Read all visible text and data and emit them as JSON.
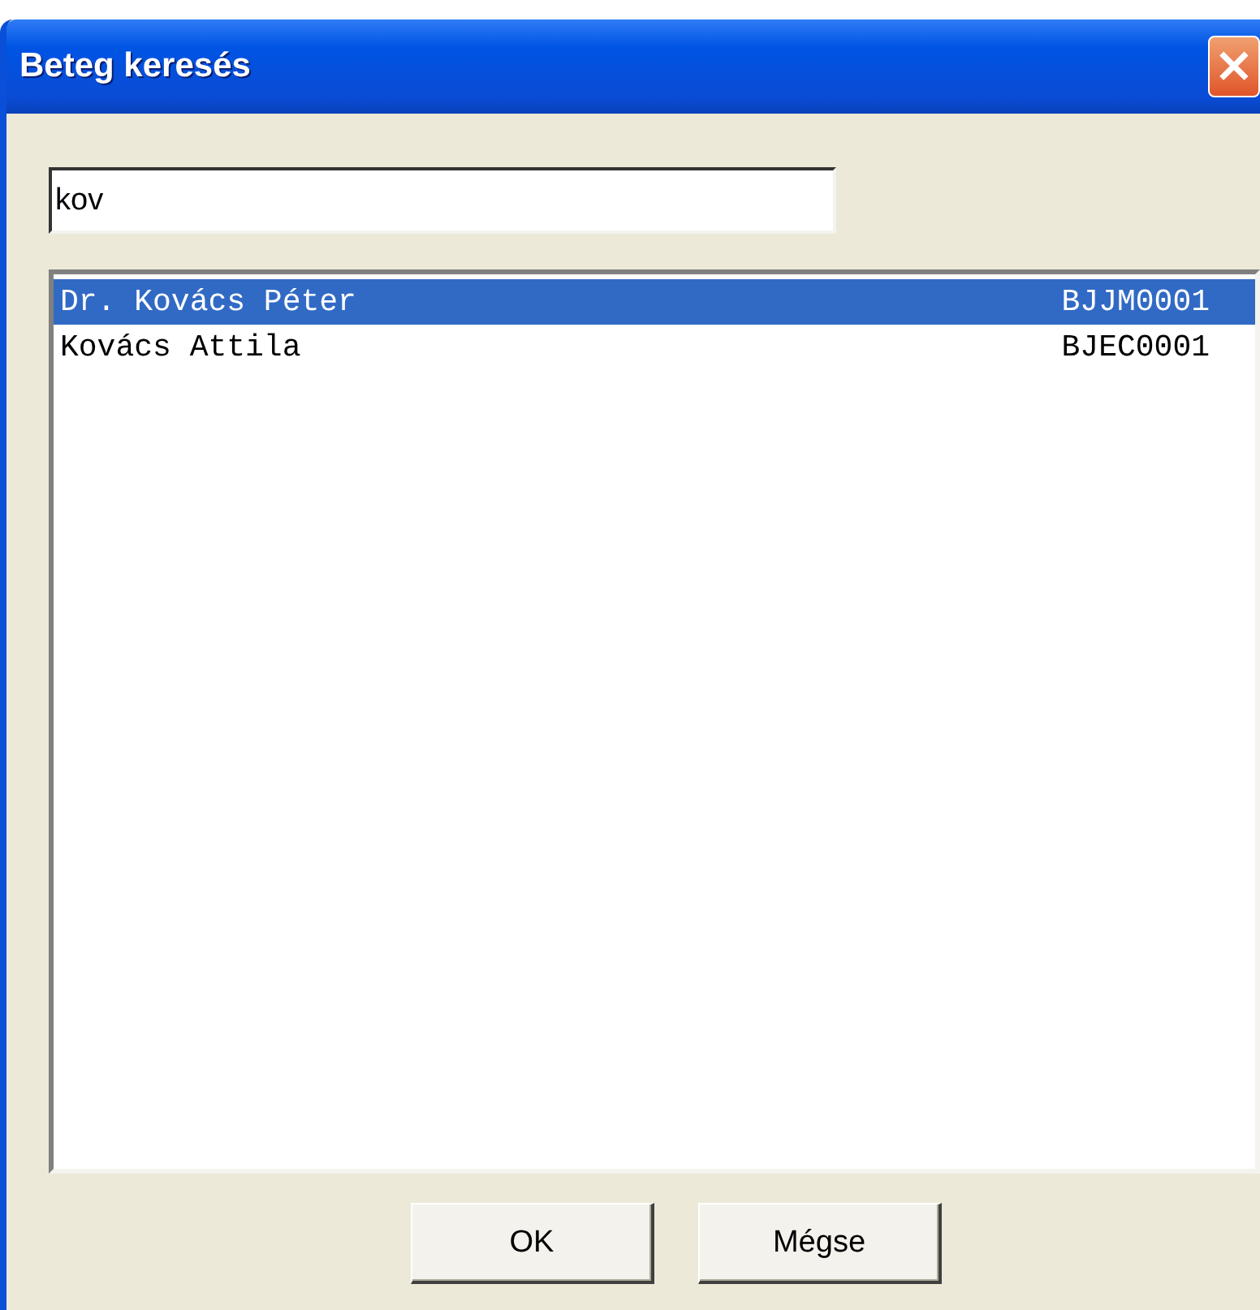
{
  "window": {
    "title": "Beteg keresés",
    "close": "×"
  },
  "search": {
    "value": "kov"
  },
  "results": [
    {
      "name": "Dr. Kovács Péter",
      "code": "BJJM0001",
      "selected": true
    },
    {
      "name": "Kovács Attila",
      "code": "BJEC0001",
      "selected": false
    }
  ],
  "buttons": [
    "OK",
    "Mégse"
  ]
}
